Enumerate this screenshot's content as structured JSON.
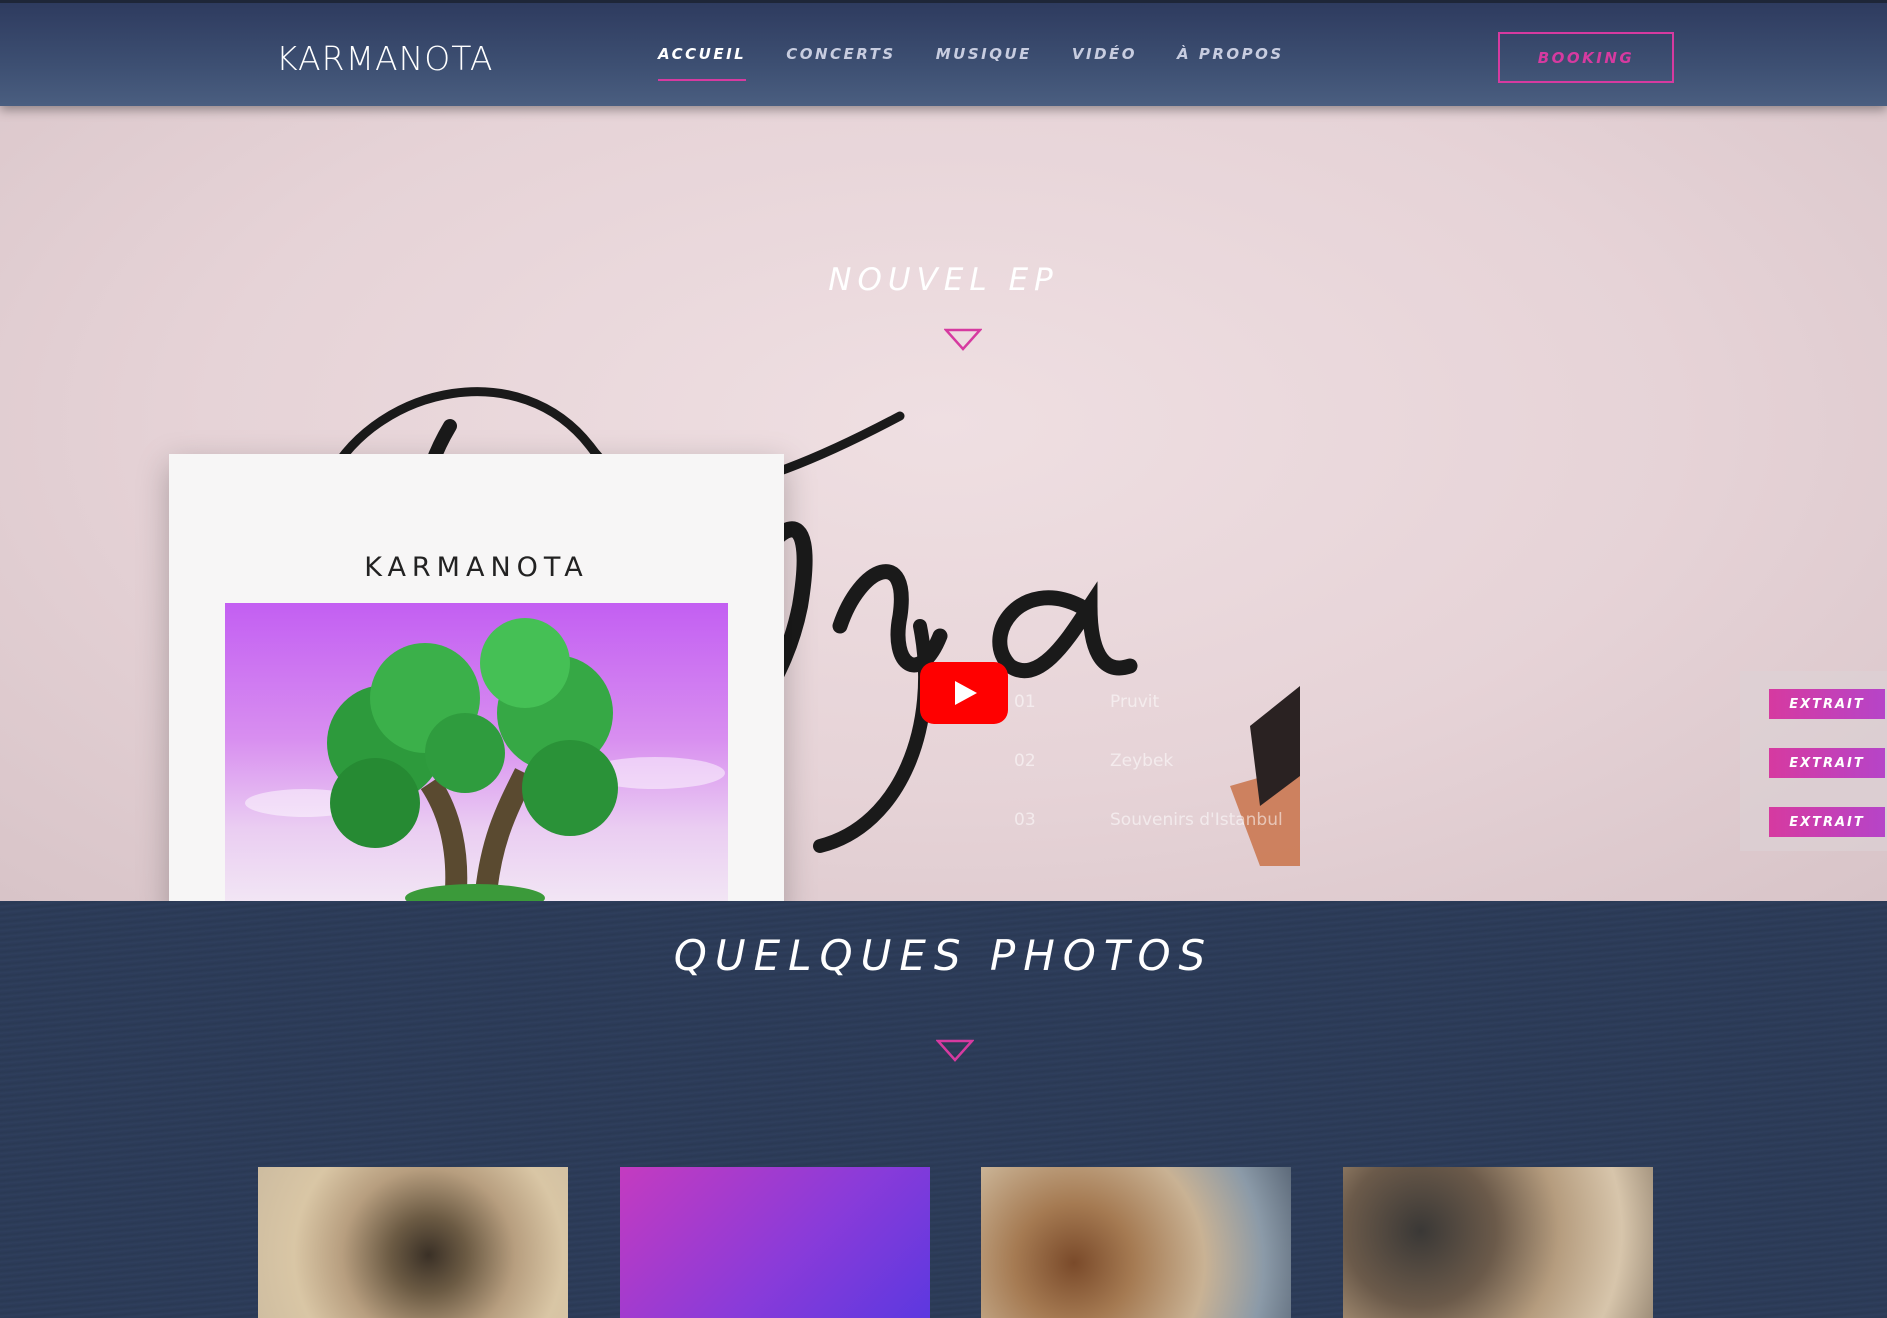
{
  "header": {
    "logo": "KARMANOTA",
    "nav": [
      {
        "label": "ACCUEIL",
        "active": true
      },
      {
        "label": "CONCERTS",
        "active": false
      },
      {
        "label": "MUSIQUE",
        "active": false
      },
      {
        "label": "VIDÉO",
        "active": false
      },
      {
        "label": "À PROPOS",
        "active": false
      }
    ],
    "booking_label": "BOOKING"
  },
  "hero": {
    "title": "NOUVEL EP",
    "album_title": "KARMANOTA",
    "tracks": [
      {
        "number": "01",
        "name": "Pruvit"
      },
      {
        "number": "02",
        "name": "Zeybek"
      },
      {
        "number": "03",
        "name": "Souvenirs d'Istanbul"
      }
    ],
    "extract_labels": [
      "EXTRAIT",
      "EXTRAIT",
      "EXTRAIT"
    ]
  },
  "photos": {
    "title": "QUELQUES PHOTOS"
  },
  "colors": {
    "accent": "#d63aa0",
    "header_bg": "#3a4b6e",
    "section_bg": "#2e3d5b"
  }
}
